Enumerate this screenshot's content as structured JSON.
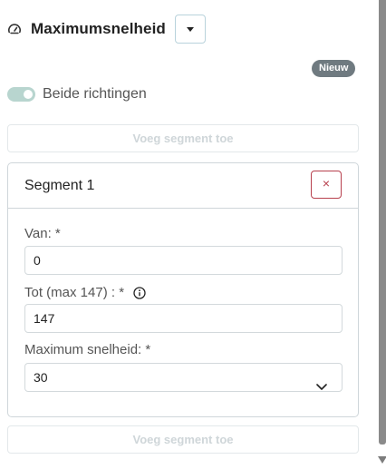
{
  "header": {
    "title": "Maximumsnelheid",
    "icon": "gauge-icon"
  },
  "badge": {
    "label": "Nieuw"
  },
  "toggle": {
    "label": "Beide richtingen",
    "checked": true
  },
  "add_segment_label": "Voeg segment toe",
  "segment": {
    "title": "Segment 1",
    "close_label": "×",
    "fields": {
      "van": {
        "label": "Van: *",
        "value": "0"
      },
      "tot": {
        "label": "Tot (max 147) : *",
        "value": "147"
      },
      "max_speed": {
        "label": "Maximum snelheid: *",
        "value": "30"
      }
    }
  },
  "colors": {
    "accent_toggle": "#b8d5cf",
    "danger": "#b7404d",
    "badge_bg": "#6f7a80"
  }
}
